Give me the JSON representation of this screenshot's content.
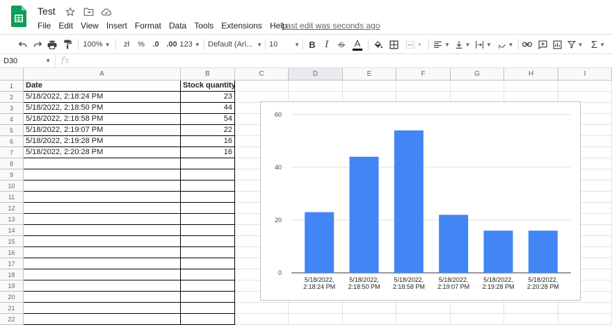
{
  "header": {
    "doc_title": "Test",
    "menus": [
      "File",
      "Edit",
      "View",
      "Insert",
      "Format",
      "Data",
      "Tools",
      "Extensions",
      "Help"
    ],
    "last_edit": "Last edit was seconds ago"
  },
  "toolbar": {
    "zoom": "100%",
    "currency": "zł",
    "percent": "%",
    "decrease_decimal": ".0",
    "increase_decimal": ".00",
    "more_formats": "123",
    "font": "Default (Ari...",
    "font_size": "10",
    "bold": "B",
    "italic": "I",
    "text_color_letter": "A"
  },
  "formula_bar": {
    "cell_ref": "D30",
    "fx": "fx",
    "value": ""
  },
  "sheet": {
    "columns": [
      "A",
      "B",
      "C",
      "D",
      "E",
      "F",
      "G",
      "H",
      "I"
    ],
    "rows": [
      "1",
      "2",
      "3",
      "4",
      "5",
      "6",
      "7",
      "8",
      "9",
      "10",
      "11",
      "12",
      "13",
      "14",
      "15",
      "16",
      "17",
      "18",
      "19",
      "20",
      "21",
      "22"
    ],
    "header_row": [
      "Date",
      "Stock quantity"
    ],
    "data_rows": [
      [
        "5/18/2022, 2:18:24 PM",
        "23"
      ],
      [
        "5/18/2022, 2:18:50 PM",
        "44"
      ],
      [
        "5/18/2022, 2:18:58 PM",
        "54"
      ],
      [
        "5/18/2022, 2:19:07 PM",
        "22"
      ],
      [
        "5/18/2022, 2:19:28 PM",
        "16"
      ],
      [
        "5/18/2022, 2:20:28 PM",
        "16"
      ]
    ]
  },
  "chart_data": {
    "type": "bar",
    "categories": [
      "5/18/2022, 2:18:24 PM",
      "5/18/2022, 2:18:50 PM",
      "5/18/2022, 2:18:58 PM",
      "5/18/2022, 2:19:07 PM",
      "5/18/2022, 2:19:28 PM",
      "5/18/2022, 2:20:28 PM"
    ],
    "category_lines": [
      [
        "5/18/2022,",
        "2:18:24 PM"
      ],
      [
        "5/18/2022,",
        "2:18:50 PM"
      ],
      [
        "5/18/2022,",
        "2:18:58 PM"
      ],
      [
        "5/18/2022,",
        "2:19:07 PM"
      ],
      [
        "5/18/2022,",
        "2:19:28 PM"
      ],
      [
        "5/18/2022,",
        "2:20:28 PM"
      ]
    ],
    "values": [
      23,
      44,
      54,
      22,
      16,
      16
    ],
    "yticks": [
      "0",
      "20",
      "40",
      "60"
    ],
    "ylim": [
      0,
      60
    ],
    "title": "",
    "xlabel": "",
    "ylabel": "",
    "grid": true,
    "bar_color": "#4285f4"
  },
  "colors": {
    "sheets_green": "#0f9d58",
    "bar": "#4285f4",
    "gridline": "#e2e2e2"
  }
}
